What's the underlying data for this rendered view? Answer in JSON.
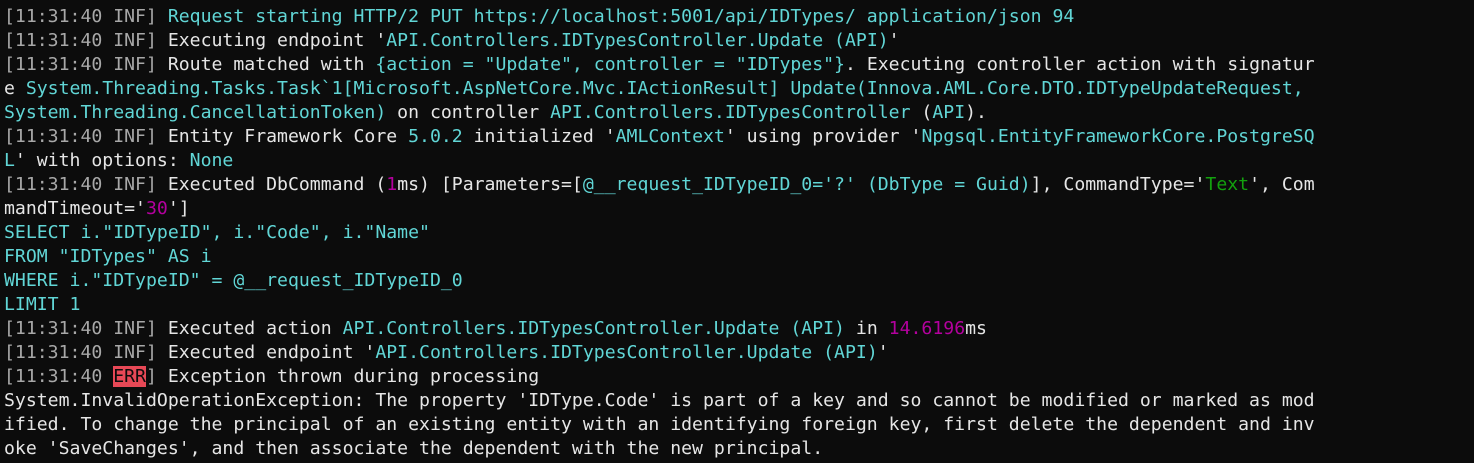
{
  "terminal": {
    "colors": {
      "background": "#0c0c0c",
      "text": "#cccccc",
      "bracket": "#a8a8a8",
      "highlight": "#61d6d6",
      "number": "#b4009e",
      "string_value": "#13a10e",
      "error_badge": "#e74856"
    },
    "lines": [
      {
        "segments": [
          {
            "t": "[11:31:40 INF] ",
            "c": "gray"
          },
          {
            "t": "Request starting HTTP/2 PUT https://localhost:5001/api/IDTypes/ application/json 94",
            "c": "teal"
          }
        ]
      },
      {
        "segments": [
          {
            "t": "[11:31:40 INF] ",
            "c": "gray"
          },
          {
            "t": "Executing endpoint '",
            "c": "white"
          },
          {
            "t": "API.Controllers.IDTypesController.Update (API)",
            "c": "teal"
          },
          {
            "t": "'",
            "c": "white"
          }
        ]
      },
      {
        "segments": [
          {
            "t": "[11:31:40 INF] ",
            "c": "gray"
          },
          {
            "t": "Route matched with ",
            "c": "white"
          },
          {
            "t": "{action = \"Update\", controller = \"IDTypes\"}",
            "c": "teal"
          },
          {
            "t": ". Executing controller action with signatur",
            "c": "white"
          }
        ]
      },
      {
        "segments": [
          {
            "t": "e ",
            "c": "white"
          },
          {
            "t": "System.Threading.Tasks.Task`1[Microsoft.AspNetCore.Mvc.IActionResult] Update(Innova.AML.Core.DTO.IDTypeUpdateRequest,",
            "c": "teal"
          }
        ]
      },
      {
        "segments": [
          {
            "t": "System.Threading.CancellationToken)",
            "c": "teal"
          },
          {
            "t": " on controller ",
            "c": "white"
          },
          {
            "t": "API.Controllers.IDTypesController",
            "c": "teal"
          },
          {
            "t": " (",
            "c": "white"
          },
          {
            "t": "API",
            "c": "teal"
          },
          {
            "t": ").",
            "c": "white"
          }
        ]
      },
      {
        "segments": [
          {
            "t": "[11:31:40 INF] ",
            "c": "gray"
          },
          {
            "t": "Entity Framework Core ",
            "c": "white"
          },
          {
            "t": "5.0.2",
            "c": "teal"
          },
          {
            "t": " initialized '",
            "c": "white"
          },
          {
            "t": "AMLContext",
            "c": "teal"
          },
          {
            "t": "' using provider '",
            "c": "white"
          },
          {
            "t": "Npgsql.EntityFrameworkCore.PostgreSQ",
            "c": "teal"
          }
        ]
      },
      {
        "segments": [
          {
            "t": "L",
            "c": "teal"
          },
          {
            "t": "' with options: ",
            "c": "white"
          },
          {
            "t": "None",
            "c": "teal"
          }
        ]
      },
      {
        "segments": [
          {
            "t": "[11:31:40 INF] ",
            "c": "gray"
          },
          {
            "t": "Executed DbCommand (",
            "c": "white"
          },
          {
            "t": "1",
            "c": "mag"
          },
          {
            "t": "ms) [Parameters=[",
            "c": "white"
          },
          {
            "t": "@__request_IDTypeID_0='?' (DbType = Guid)",
            "c": "teal"
          },
          {
            "t": "], CommandType='",
            "c": "white"
          },
          {
            "t": "Text",
            "c": "green"
          },
          {
            "t": "', Com",
            "c": "white"
          }
        ]
      },
      {
        "segments": [
          {
            "t": "mandTimeout='",
            "c": "white"
          },
          {
            "t": "30",
            "c": "mag"
          },
          {
            "t": "']",
            "c": "white"
          }
        ]
      },
      {
        "segments": [
          {
            "t": "SELECT i.\"IDTypeID\", i.\"Code\", i.\"Name\"",
            "c": "teal"
          }
        ]
      },
      {
        "segments": [
          {
            "t": "FROM \"IDTypes\" AS i",
            "c": "teal"
          }
        ]
      },
      {
        "segments": [
          {
            "t": "WHERE i.\"IDTypeID\" = @__request_IDTypeID_0",
            "c": "teal"
          }
        ]
      },
      {
        "segments": [
          {
            "t": "LIMIT 1",
            "c": "teal"
          }
        ]
      },
      {
        "segments": [
          {
            "t": "[11:31:40 INF] ",
            "c": "gray"
          },
          {
            "t": "Executed action ",
            "c": "white"
          },
          {
            "t": "API.Controllers.IDTypesController.Update (API)",
            "c": "teal"
          },
          {
            "t": " in ",
            "c": "white"
          },
          {
            "t": "14.6196",
            "c": "mag"
          },
          {
            "t": "ms",
            "c": "white"
          }
        ]
      },
      {
        "segments": [
          {
            "t": "[11:31:40 INF] ",
            "c": "gray"
          },
          {
            "t": "Executed endpoint '",
            "c": "white"
          },
          {
            "t": "API.Controllers.IDTypesController.Update (API)",
            "c": "teal"
          },
          {
            "t": "'",
            "c": "white"
          }
        ]
      },
      {
        "segments": [
          {
            "t": "[11:31:40 ",
            "c": "gray"
          },
          {
            "t": "ERR",
            "c": "err"
          },
          {
            "t": "] ",
            "c": "gray"
          },
          {
            "t": "Exception thrown during processing",
            "c": "white"
          }
        ]
      },
      {
        "segments": [
          {
            "t": "System.InvalidOperationException: The property 'IDType.Code' is part of a key and so cannot be modified or marked as mod",
            "c": "white"
          }
        ]
      },
      {
        "segments": [
          {
            "t": "ified. To change the principal of an existing entity with an identifying foreign key, first delete the dependent and inv",
            "c": "white"
          }
        ]
      },
      {
        "segments": [
          {
            "t": "oke 'SaveChanges', and then associate the dependent with the new principal.",
            "c": "white"
          }
        ]
      }
    ]
  }
}
